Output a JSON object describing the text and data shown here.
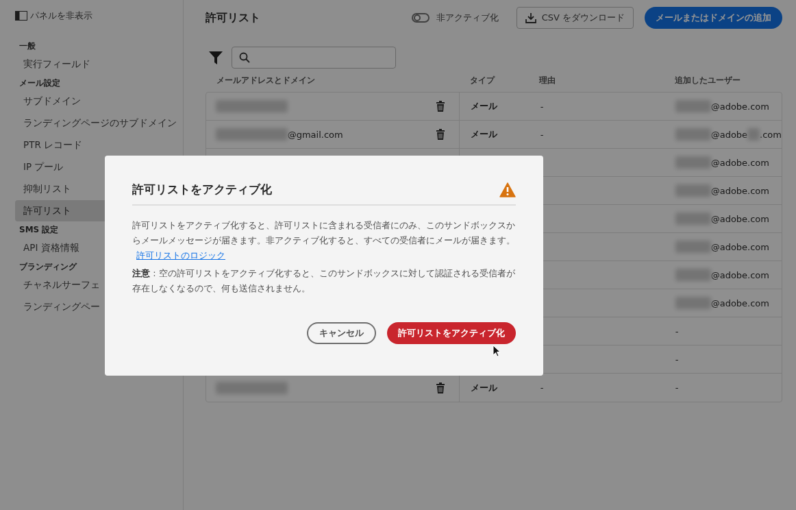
{
  "sidebar": {
    "toggle_label": "パネルを非表示",
    "sections": [
      {
        "heading": "一般",
        "items": [
          {
            "label": "実行フィールド",
            "selected": false
          }
        ]
      },
      {
        "heading": "メール設定",
        "items": [
          {
            "label": "サブドメイン",
            "selected": false
          },
          {
            "label": "ランディングページのサブドメイン",
            "selected": false
          },
          {
            "label": "PTR レコード",
            "selected": false
          },
          {
            "label": "IP プール",
            "selected": false
          },
          {
            "label": "抑制リスト",
            "selected": false
          },
          {
            "label": "許可リスト",
            "selected": true
          }
        ]
      },
      {
        "heading": "SMS 設定",
        "items": [
          {
            "label": "API 資格情報",
            "selected": false
          }
        ]
      },
      {
        "heading": "ブランディング",
        "items": [
          {
            "label": "チャネルサーフェ",
            "selected": false
          },
          {
            "label": "ランディングペー",
            "selected": false
          }
        ]
      }
    ]
  },
  "header": {
    "title": "許可リスト",
    "toggle": {
      "label": "非アクティブ化",
      "on": false
    },
    "csv_button": "CSV をダウンロード",
    "add_button": "メールまたはドメインの追加"
  },
  "table": {
    "columns": [
      "メールアドレスとドメイン",
      "タイプ",
      "理由",
      "追加したユーザー"
    ],
    "rows": [
      {
        "email": [
          {
            "kind": "redacted"
          }
        ],
        "type": "メール",
        "reason": "-",
        "added_by": [
          {
            "kind": "redacted"
          },
          {
            "kind": "text",
            "text": "@adobe.com"
          }
        ]
      },
      {
        "email": [
          {
            "kind": "redacted"
          },
          {
            "kind": "text",
            "text": "@gmail.com"
          }
        ],
        "type": "メール",
        "reason": "-",
        "added_by": [
          {
            "kind": "redacted"
          },
          {
            "kind": "text",
            "text": "@adobe"
          },
          {
            "kind": "redacted"
          },
          {
            "kind": "text",
            "text": ".com"
          }
        ]
      },
      {
        "added_by": [
          {
            "kind": "redacted"
          },
          {
            "kind": "text",
            "text": "@adobe.com"
          }
        ]
      },
      {
        "added_by": [
          {
            "kind": "redacted"
          },
          {
            "kind": "text",
            "text": "@adobe.com"
          }
        ]
      },
      {
        "added_by": [
          {
            "kind": "redacted"
          },
          {
            "kind": "text",
            "text": "@adobe.com"
          }
        ]
      },
      {
        "added_by": [
          {
            "kind": "redacted"
          },
          {
            "kind": "text",
            "text": "@adobe.com"
          }
        ]
      },
      {
        "added_by": [
          {
            "kind": "redacted"
          },
          {
            "kind": "text",
            "text": "@adobe.com"
          }
        ]
      },
      {
        "added_by": [
          {
            "kind": "redacted"
          },
          {
            "kind": "text",
            "text": "@adobe.com"
          }
        ]
      },
      {
        "added_by": [
          {
            "kind": "text",
            "text": "-"
          }
        ]
      },
      {
        "added_by": [
          {
            "kind": "text",
            "text": "-"
          }
        ]
      },
      {
        "email": [
          {
            "kind": "redacted"
          }
        ],
        "type": "メール",
        "reason": "-",
        "added_by": [
          {
            "kind": "text",
            "text": "-"
          }
        ]
      }
    ]
  },
  "dialog": {
    "title": "許可リストをアクティブ化",
    "message": "許可リストをアクティブ化すると、許可リストに含まれる受信者にのみ、このサンドボックスからメールメッセージが届きます。非アクティブ化すると、すべての受信者にメールが届きます。",
    "link": "許可リストのロジック",
    "note": "**注意** : 空の許可リストをアクティブ化すると、このサンドボックスに対して認証される受信者が存在しなくなるので、何も送信されません。",
    "cancel_button": "キャンセル",
    "confirm_button": "許可リストをアクティブ化"
  }
}
